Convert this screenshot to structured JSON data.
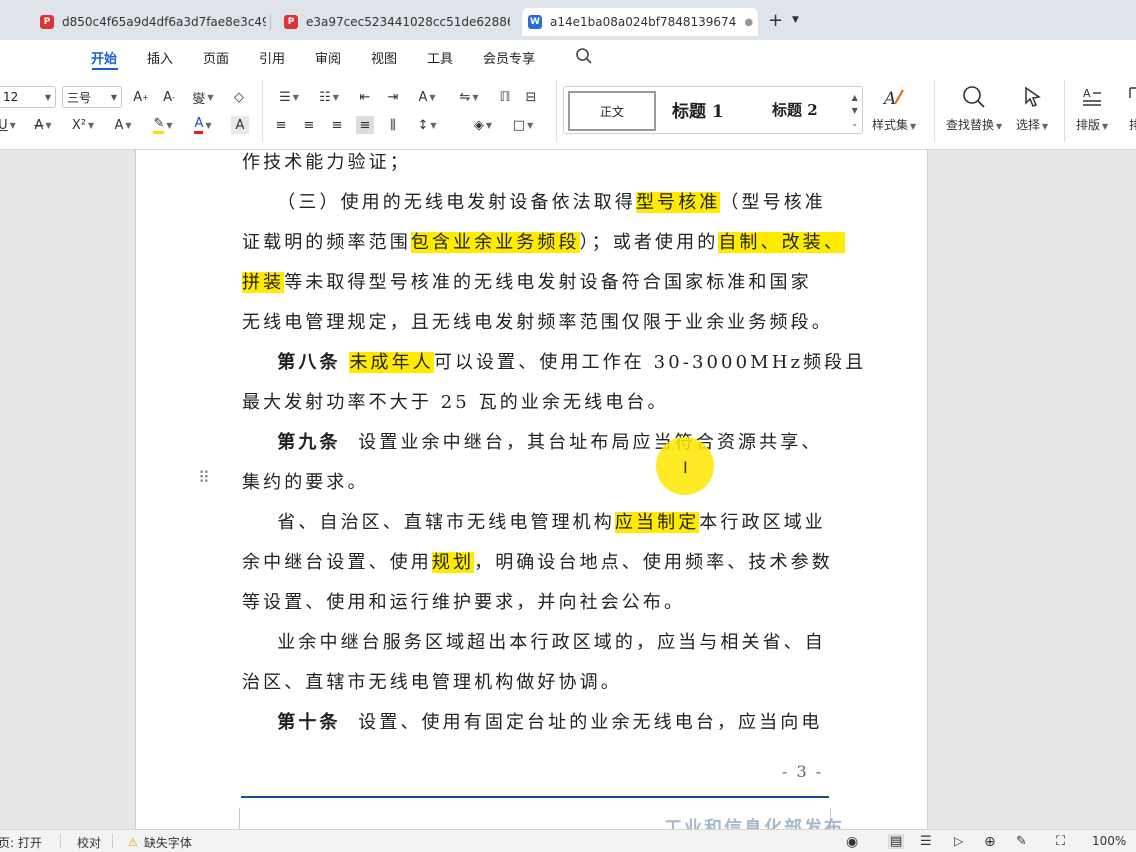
{
  "tabs": [
    {
      "label": "d850c4f65a9d4df6a3d7fae8e3c49",
      "type": "pdf"
    },
    {
      "label": "e3a97cec523441028cc51de628861",
      "type": "pdf"
    },
    {
      "label": "a14e1ba08a024bf7848139674",
      "type": "word",
      "active": true
    }
  ],
  "tab_icons": {
    "pdf": "P",
    "word": "W"
  },
  "menu": [
    "开始",
    "插入",
    "页面",
    "引用",
    "审阅",
    "视图",
    "工具",
    "会员专享"
  ],
  "ribbon": {
    "font_size": "12",
    "font_size_name": "三号",
    "styles": {
      "normal": "正文",
      "h1": "标题 1",
      "h2": "标题 2"
    },
    "style_set": "样式集",
    "find_replace": "查找替换",
    "select": "选择",
    "layout": "排版",
    "layout2": "排"
  },
  "document": {
    "lines": [
      {
        "segments": [
          {
            "t": "作技术能力验证；"
          }
        ]
      },
      {
        "segments": [
          {
            "t": "    （三）使用的无线电发射设备依法取得"
          },
          {
            "t": "型号核准",
            "hl": true
          },
          {
            "t": "（型号核准"
          }
        ]
      },
      {
        "segments": [
          {
            "t": "证载明的频率范围"
          },
          {
            "t": "包含业余业务频段",
            "hl": true
          },
          {
            "t": "）；或者使用的"
          },
          {
            "t": "自制、改装、",
            "hl": true
          }
        ]
      },
      {
        "segments": [
          {
            "t": "拼装",
            "hl": true
          },
          {
            "t": "等未取得型号核准的无线电发射设备符合国家标准和国家"
          }
        ]
      },
      {
        "segments": [
          {
            "t": "无线电管理规定，且无线电发射频率范围仅限于业余业务频段。"
          }
        ]
      },
      {
        "segments": [
          {
            "t": "    "
          },
          {
            "t": "第八条",
            "b": true
          },
          {
            "t": " "
          },
          {
            "t": "未成年人",
            "hl": true
          },
          {
            "t": "可以设置、使用工作在 30-3000MHz频段且"
          }
        ]
      },
      {
        "segments": [
          {
            "t": "最大发射功率不大于 25 瓦的业余无线电台。"
          }
        ]
      },
      {
        "segments": [
          {
            "t": "    "
          },
          {
            "t": "第九条",
            "b": true
          },
          {
            "t": "  设置业余中继台，其台址布局应当符合资源共享、"
          }
        ]
      },
      {
        "segments": [
          {
            "t": "集约的要求。"
          }
        ]
      },
      {
        "segments": [
          {
            "t": "    省、自治区、直辖市无线电管理机构"
          },
          {
            "t": "应当制定",
            "hl": true
          },
          {
            "t": "本行政区域业"
          }
        ]
      },
      {
        "segments": [
          {
            "t": "余中继台设置、使用"
          },
          {
            "t": "规划",
            "hl": true
          },
          {
            "t": "，明确设台地点、使用频率、技术参数"
          }
        ]
      },
      {
        "segments": [
          {
            "t": "等设置、使用和运行维护要求，并向社会公布。"
          }
        ]
      },
      {
        "segments": [
          {
            "t": "    业余中继台服务区域超出本行政区域的，应当与相关省、自"
          }
        ]
      },
      {
        "segments": [
          {
            "t": "治区、直辖市无线电管理机构做好协调。"
          }
        ]
      },
      {
        "segments": [
          {
            "t": "    "
          },
          {
            "t": "第十条",
            "b": true
          },
          {
            "t": "  设置、使用有固定台址的业余无线电台，应当向电"
          }
        ]
      }
    ],
    "page_number": "- 3 -",
    "footer_text": "工业和信息化部发布"
  },
  "status": {
    "left_text": "页: 打开",
    "proofread": "校对",
    "missing_font": "缺失字体",
    "zoom": "100%"
  },
  "colors": {
    "highlight": "#ffeb00",
    "accent": "#1a5fd0",
    "footer_rule": "#1a4f8f"
  }
}
